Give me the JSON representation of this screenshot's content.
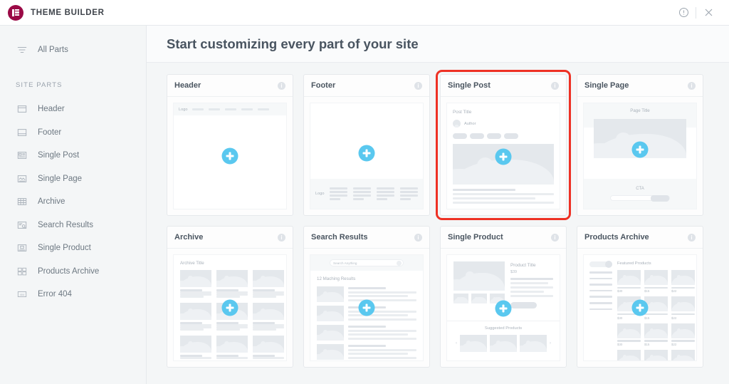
{
  "topbar": {
    "app_title": "THEME BUILDER",
    "logo_icon": "elementor-logo-icon",
    "logo_color": "#9B0A46",
    "info_icon": "info-circle-icon",
    "close_icon": "close-x-icon"
  },
  "sidebar": {
    "all_parts": {
      "label": "All Parts",
      "icon": "hamburger-filter-icon"
    },
    "section_label": "SITE PARTS",
    "items": [
      {
        "label": "Header",
        "icon": "header-layout-icon"
      },
      {
        "label": "Footer",
        "icon": "footer-layout-icon"
      },
      {
        "label": "Single Post",
        "icon": "single-post-icon"
      },
      {
        "label": "Single Page",
        "icon": "single-page-icon"
      },
      {
        "label": "Archive",
        "icon": "archive-grid-icon"
      },
      {
        "label": "Search Results",
        "icon": "search-results-icon"
      },
      {
        "label": "Single Product",
        "icon": "single-product-icon"
      },
      {
        "label": "Products Archive",
        "icon": "products-archive-icon"
      },
      {
        "label": "Error 404",
        "icon": "error-404-icon"
      }
    ]
  },
  "main": {
    "page_title": "Start customizing every part of your site",
    "accent_add_color": "#5ac8ef",
    "highlight_color": "#ee3124",
    "cards": [
      {
        "title": "Header",
        "info_icon": "info-circle-icon",
        "add_icon": "plus-circle-icon",
        "preview": {
          "logo_label": "Logo",
          "nav_items": 5
        }
      },
      {
        "title": "Footer",
        "info_icon": "info-circle-icon",
        "add_icon": "plus-circle-icon",
        "preview": {
          "logo_label": "Logo",
          "columns": 4,
          "links_per_column": 4
        }
      },
      {
        "title": "Single Post",
        "info_icon": "info-circle-icon",
        "add_icon": "plus-circle-icon",
        "highlighted": true,
        "preview": {
          "post_title": "Post Title",
          "author_label": "Author",
          "tags": 4,
          "text_lines": 4
        }
      },
      {
        "title": "Single Page",
        "info_icon": "info-circle-icon",
        "add_icon": "plus-circle-icon",
        "preview": {
          "page_title": "Page Title",
          "cta_label": "CTA"
        }
      },
      {
        "title": "Archive",
        "info_icon": "info-circle-icon",
        "add_icon": "plus-circle-icon",
        "preview": {
          "archive_title": "Archive Title",
          "grid_columns": 3,
          "grid_rows": 3
        }
      },
      {
        "title": "Search Results",
        "info_icon": "info-circle-icon",
        "add_icon": "plus-circle-icon",
        "preview": {
          "search_placeholder": "Search Anything",
          "search_icon": "magnifier-icon",
          "results_count": "12 Maching Results",
          "result_rows": 4
        }
      },
      {
        "title": "Single Product",
        "info_icon": "info-circle-icon",
        "add_icon": "plus-circle-icon",
        "preview": {
          "product_title": "Product Title",
          "price": "$39",
          "thumbnails": 3,
          "suggested_label": "Suggested Products",
          "prev_arrow": "‹",
          "next_arrow": "›"
        }
      },
      {
        "title": "Products Archive",
        "info_icon": "info-circle-icon",
        "add_icon": "plus-circle-icon",
        "preview": {
          "featured_label": "Featured Products",
          "filter_toggle": "filter-toggle",
          "filter_lines": 7,
          "prices": [
            "$30",
            "$15",
            "$22"
          ]
        }
      }
    ]
  }
}
